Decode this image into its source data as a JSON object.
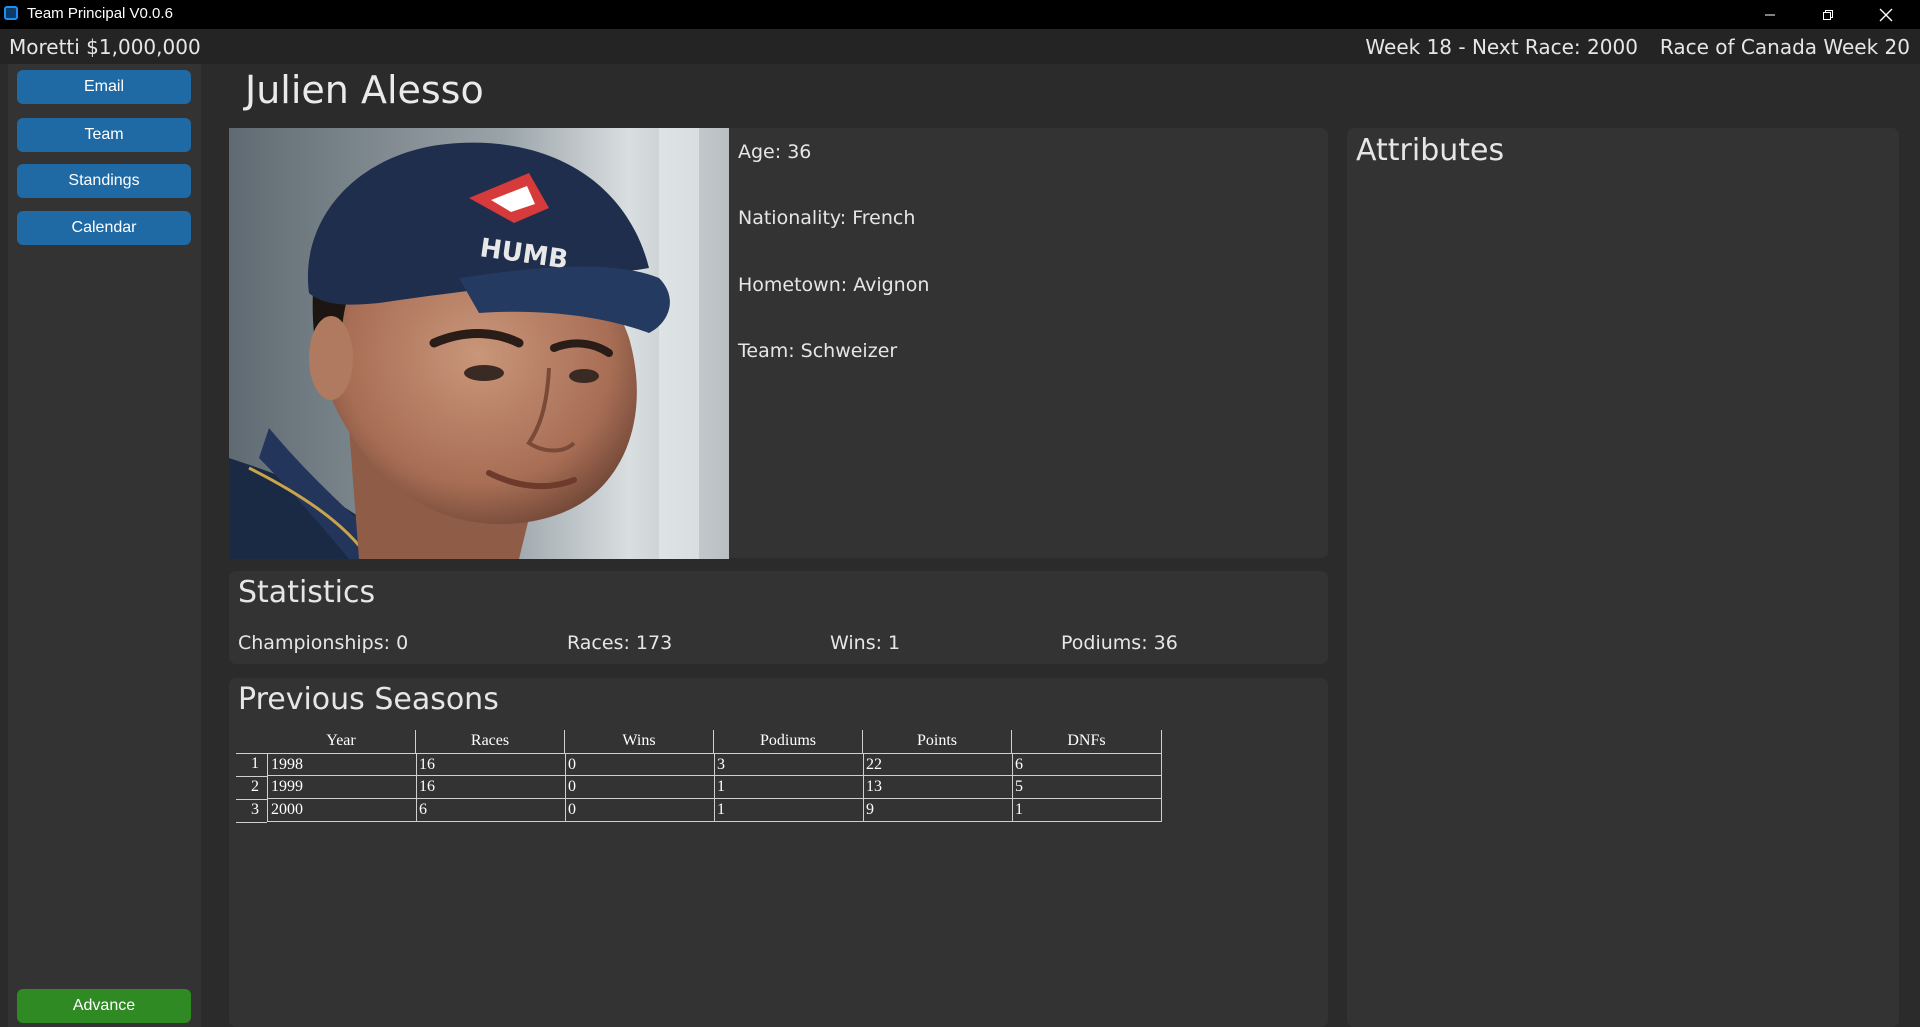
{
  "window": {
    "title": "Team Principal V0.0.6",
    "controls": [
      "minimize-icon",
      "restore-icon",
      "close-icon"
    ]
  },
  "status": {
    "money": "Moretti $1,000,000",
    "week": "Week 18 - Next Race: 2000",
    "next_race": "Race of Canada Week 20"
  },
  "sidebar": {
    "items": [
      {
        "label": "Email"
      },
      {
        "label": "Team"
      },
      {
        "label": "Standings"
      },
      {
        "label": "Calendar"
      }
    ],
    "advance": "Advance"
  },
  "driver": {
    "name": "Julien Alesso",
    "age": "Age: 36",
    "nationality": "Nationality: French",
    "hometown": "Hometown: Avignon",
    "team": "Team: Schweizer"
  },
  "attributes": {
    "title": "Attributes"
  },
  "statistics": {
    "title": "Statistics",
    "championships": "Championships: 0",
    "races": "Races: 173",
    "wins": "Wins: 1",
    "podiums": "Podiums: 36"
  },
  "seasons": {
    "title": "Previous Seasons",
    "columns": [
      "Year",
      "Races",
      "Wins",
      "Podiums",
      "Points",
      "DNFs"
    ],
    "rows": [
      {
        "index": "1",
        "cells": [
          "1998",
          "16",
          "0",
          "3",
          "22",
          "6"
        ]
      },
      {
        "index": "2",
        "cells": [
          "1999",
          "16",
          "0",
          "1",
          "13",
          "5"
        ]
      },
      {
        "index": "3",
        "cells": [
          "2000",
          "6",
          "0",
          "1",
          "9",
          "1"
        ]
      }
    ]
  },
  "colors": {
    "button_blue": "#1f6aa5",
    "button_green": "#2f8a23",
    "panel": "#333333",
    "background": "#2b2b2b"
  }
}
